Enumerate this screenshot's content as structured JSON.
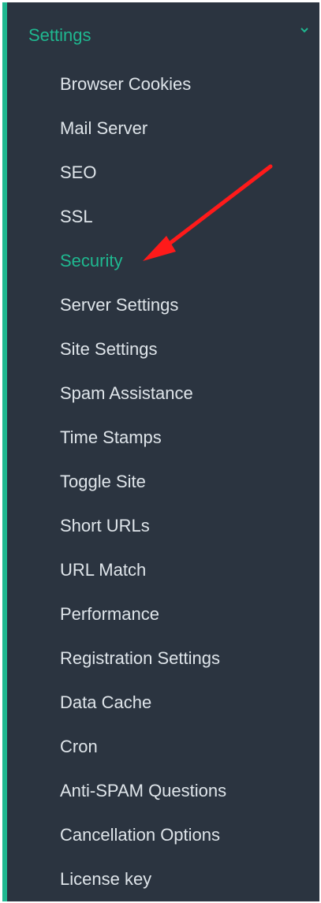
{
  "section": {
    "title": "Settings",
    "icon": "chevron-down-icon",
    "accent_color": "#1fb890"
  },
  "menu": {
    "items": [
      {
        "label": "Browser Cookies",
        "active": false
      },
      {
        "label": "Mail Server",
        "active": false
      },
      {
        "label": "SEO",
        "active": false
      },
      {
        "label": "SSL",
        "active": false
      },
      {
        "label": "Security",
        "active": true
      },
      {
        "label": "Server Settings",
        "active": false
      },
      {
        "label": "Site Settings",
        "active": false
      },
      {
        "label": "Spam Assistance",
        "active": false
      },
      {
        "label": "Time Stamps",
        "active": false
      },
      {
        "label": "Toggle Site",
        "active": false
      },
      {
        "label": "Short URLs",
        "active": false
      },
      {
        "label": "URL Match",
        "active": false
      },
      {
        "label": "Performance",
        "active": false
      },
      {
        "label": "Registration Settings",
        "active": false
      },
      {
        "label": "Data Cache",
        "active": false
      },
      {
        "label": "Cron",
        "active": false
      },
      {
        "label": "Anti-SPAM Questions",
        "active": false
      },
      {
        "label": "Cancellation Options",
        "active": false
      },
      {
        "label": "License key",
        "active": false
      }
    ]
  },
  "annotation": {
    "color": "#ff1a1a",
    "target": "Security"
  },
  "colors": {
    "background": "#2b3440",
    "text": "#dfe5ea",
    "accent": "#1fb890"
  }
}
